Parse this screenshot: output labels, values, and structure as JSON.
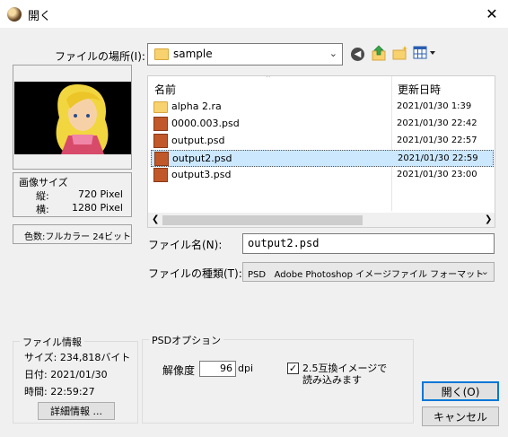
{
  "window": {
    "title": "開く",
    "close_glyph": "✕"
  },
  "location": {
    "label": "ファイルの場所(I):",
    "value": "sample"
  },
  "list": {
    "header_name": "名前",
    "header_date": "更新日時",
    "files": [
      {
        "name": "alpha 2.ra",
        "date": "2021/01/30 1:39",
        "kind": "folder",
        "selected": false
      },
      {
        "name": "0000.003.psd",
        "date": "2021/01/30 22:42",
        "kind": "psd",
        "selected": false
      },
      {
        "name": "output.psd",
        "date": "2021/01/30 22:57",
        "kind": "psd",
        "selected": false
      },
      {
        "name": "output2.psd",
        "date": "2021/01/30 22:59",
        "kind": "psd",
        "selected": true
      },
      {
        "name": "output3.psd",
        "date": "2021/01/30 23:00",
        "kind": "psd",
        "selected": false
      }
    ]
  },
  "image_size": {
    "title": "画像サイズ",
    "height_label": "縦:",
    "height_value": "720 Pixel",
    "width_label": "横:",
    "width_value": "1280 Pixel"
  },
  "color_depth": "色数:フルカラー 24ビット",
  "filename": {
    "label": "ファイル名(N):",
    "value": "output2.psd"
  },
  "filetype": {
    "label": "ファイルの種類(T):",
    "value": "PSD   Adobe Photoshop イメージファイル フォーマット"
  },
  "file_info": {
    "title": "ファイル情報",
    "size": "サイズ: 234,818バイト",
    "date": "日付:  2021/01/30",
    "time": "時間:  22:59:27",
    "detail_button": "詳細情報 ..."
  },
  "psd_options": {
    "title": "PSDオプション",
    "resolution_label": "解像度",
    "resolution_value": "96",
    "resolution_unit": "dpi",
    "compat_line1": "2.5互換イメージで",
    "compat_line2": "読み込みます",
    "compat_checked": true,
    "check_glyph": "✓"
  },
  "buttons": {
    "open": "開く(O)",
    "cancel": "キャンセル"
  },
  "colors": {
    "selection": "#cce8ff",
    "default_button_border": "#0078d7",
    "folder": "#f7d26e",
    "psd_icon": "#c0582a"
  }
}
